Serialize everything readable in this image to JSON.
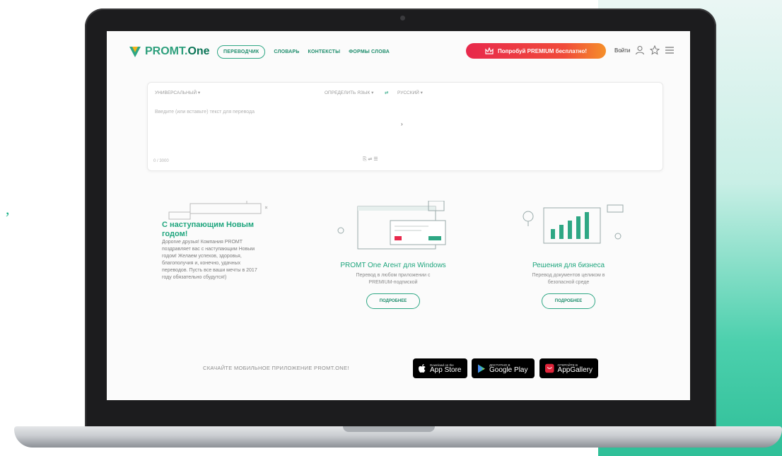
{
  "header": {
    "logo_text": "PROMT.",
    "logo_text_two": "One",
    "nav": [
      "ПЕРЕВОДЧИК",
      "СЛОВАРЬ",
      "КОНТЕКСТЫ",
      "ФОРМЫ СЛОВА"
    ],
    "premium_label": "Попробуй PREMIUM бесплатно!",
    "login_label": "Войти"
  },
  "translator": {
    "mode": "УНИВЕРСАЛЬНЫЙ ▾",
    "source_lang": "ОПРЕДЕЛИТЬ ЯЗЫК ▾",
    "swap": "⇄",
    "target_lang": "РУССКИЙ ▾",
    "placeholder": "Введите (или вставьте) текст для перевода",
    "arrow": "›",
    "counter": "0 / 3000",
    "tools": "⎘ ⇌ ☰"
  },
  "cards": {
    "newyear": {
      "title": "С наступающим Новым годом!",
      "text": "Дорогие друзья! Компания PROMT поздравляет вас с наступающим Новым годом! Желаем успехов, здоровья, благополучия и, конечно, удачных переводов. Пусть все ваши мечты в 2017 году обязательно сбудутся!)"
    },
    "agent": {
      "title": "PROMT One Агент для Windows",
      "text": "Перевод в любом приложении с PREMIUM-подпиской",
      "button": "ПОДРОБНЕЕ"
    },
    "business": {
      "title": "Решения для бизнеса",
      "text": "Перевод документов целиком в безопасной среде",
      "button": "ПОДРОБНЕЕ"
    }
  },
  "download": {
    "label": "СКАЧАЙТЕ МОБИЛЬНОЕ ПРИЛОЖЕНИЕ PROMT.ONE!",
    "stores": [
      {
        "small": "Download on the",
        "big": "App Store"
      },
      {
        "small": "ДОСТУПНО В",
        "big": "Google Play"
      },
      {
        "small": "ОТКРОЙТЕ В",
        "big": "AppGallery"
      }
    ]
  },
  "colors": {
    "brand_green": "#1ea57d",
    "premium_red": "#e8294c",
    "premium_orange": "#f58f2a"
  }
}
